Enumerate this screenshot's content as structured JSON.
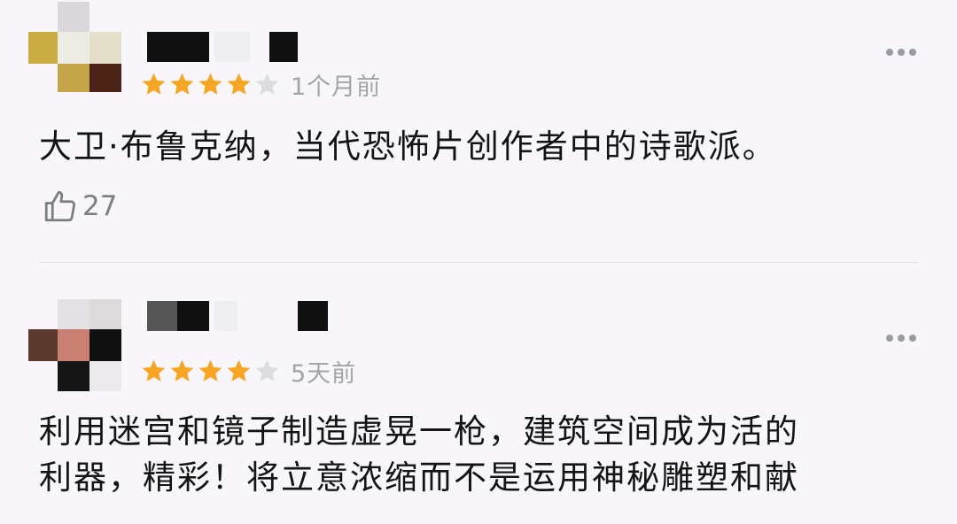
{
  "reviews": [
    {
      "stars_filled": 4,
      "stars_total": 5,
      "time": "1个月前",
      "content": "大卫·布鲁克纳，当代恐怖片创作者中的诗歌派。",
      "likes": "27"
    },
    {
      "stars_filled": 4,
      "stars_total": 5,
      "time": "5天前",
      "content_lines": [
        "利用迷宫和镜子制造虚晃一枪，建筑空间成为活的",
        "利器，精彩！将立意浓缩而不是运用神秘雕塑和献"
      ]
    }
  ],
  "icons": {
    "star_filled": "star-icon",
    "star_empty": "star-empty-icon",
    "more": "more-dots-icon",
    "like": "thumbs-up-icon"
  },
  "colors": {
    "background": "#f8f6fb",
    "star_filled": "#f6a623",
    "star_empty": "#dcdbe0",
    "text": "#141414",
    "muted": "#a4a2aa"
  }
}
